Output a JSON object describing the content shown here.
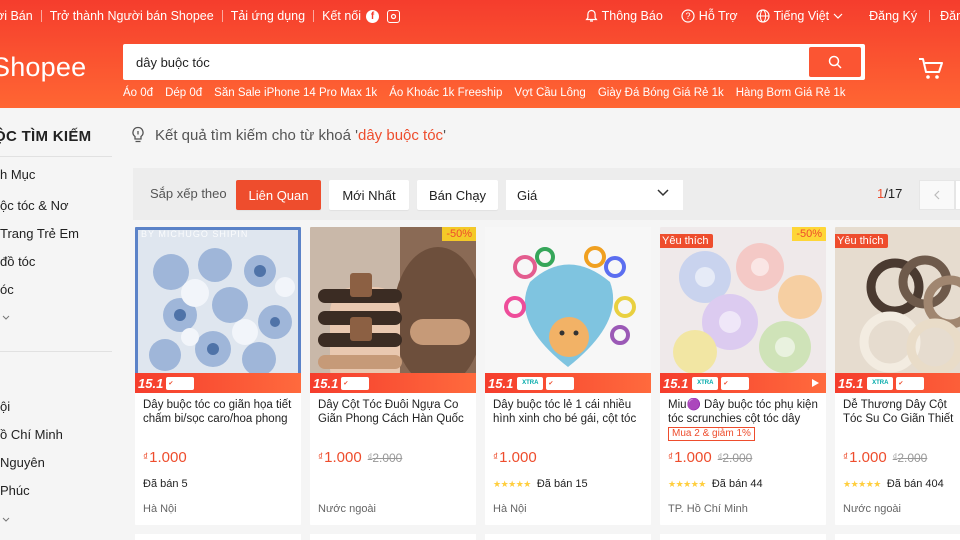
{
  "header": {
    "top_left": [
      "ời Bán",
      "Trở thành Người bán Shopee",
      "Tải ứng dụng",
      "Kết nối"
    ],
    "top_right": {
      "notify": "Thông Báo",
      "help": "Hỗ Trợ",
      "lang": "Tiếng Việt",
      "register": "Đăng Ký",
      "login": "Đăng"
    },
    "logo": "Shopee",
    "search_value": "dây buộc tóc",
    "suggestions": [
      "Áo 0đ",
      "Dép 0đ",
      "Săn Sale iPhone 14 Pro Max 1k",
      "Áo Khoác 1k Freeship",
      "Vợt Cầu Lông",
      "Giày Đá Bóng Giá Rẻ 1k",
      "Hàng Bơm Giá Rẻ 1k"
    ]
  },
  "sidebar": {
    "title": "ỘC TÌM KIẾM",
    "cat_items": [
      "h Mục",
      "ộc tóc & Nơ",
      "Trang Trẻ Em",
      "đồ tóc",
      "óc"
    ],
    "loc_items": [
      "ội",
      "ồ Chí Minh",
      "Nguyên",
      "Phúc"
    ]
  },
  "result": {
    "prefix": "Kết quả tìm kiếm cho từ khoá '",
    "keyword": "dây buộc tóc",
    "suffix": "'"
  },
  "sortbar": {
    "label": "Sắp xếp theo",
    "relevance": "Liên Quan",
    "newest": "Mới Nhất",
    "bestseller": "Bán Chạy",
    "price": "Giá",
    "page_current": "1",
    "page_total": "/17"
  },
  "products": [
    {
      "name": "Dây buộc tóc co giãn họa tiết chấm bi/sọc caro/hoa phong cách Hàn Quốc",
      "price": "1.000",
      "old_price": "",
      "discount": "",
      "like": "",
      "promo": "",
      "stars": "",
      "sold": "Đã bán 5",
      "location": "Hà Nội",
      "watermark": "BY MICHUGO SHIPIN",
      "frame_num": "15.1"
    },
    {
      "name": "Dây Cột Tóc Đuôi Ngựa Co Giãn Phong Cách Hàn Quốc Thời Trang",
      "price": "1.000",
      "old_price": "2.000",
      "discount": "-50%",
      "like": "",
      "promo": "",
      "stars": "",
      "sold": "",
      "location": "Nước ngoài",
      "watermark": "",
      "frame_num": "15.1"
    },
    {
      "name": "Dây buộc tóc lẻ 1 cái nhiều hình xinh cho bé gái, cột tóc cho bé",
      "price": "1.000",
      "old_price": "",
      "discount": "",
      "like": "",
      "promo": "",
      "stars": "★★★★★",
      "sold": "Đã bán 15",
      "location": "Hà Nội",
      "watermark": "",
      "frame_num": "15.1"
    },
    {
      "name": "Miu🟣 Dây buộc tóc phụ kiện tóc scrunchies cột tóc dây cột tóc",
      "price": "1.000",
      "old_price": "2.000",
      "discount": "-50%",
      "like": "Yêu thích",
      "promo": "Mua 2 & giảm 1%",
      "stars": "★★★★★",
      "sold": "Đã bán 44",
      "location": "TP. Hồ Chí Minh",
      "watermark": "",
      "frame_num": "15.1"
    },
    {
      "name": "Dễ Thương Dây Cột Tóc Su Co Giãn Thiết Kế Đơn",
      "price": "1.000",
      "old_price": "2.000",
      "discount": "",
      "like": "Yêu thích",
      "promo": "",
      "stars": "★★★★★",
      "sold": "Đã bán 404",
      "location": "Nước ngoài",
      "watermark": "",
      "frame_num": "15.1"
    }
  ],
  "currency": "₫",
  "colors": {
    "brand": "#ee4d2d",
    "header": "#f53d2d"
  }
}
